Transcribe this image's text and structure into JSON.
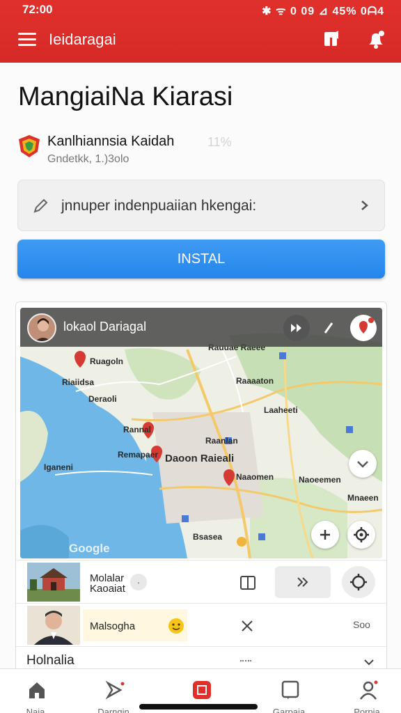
{
  "status_bar": {
    "time": "72:00",
    "indicators": "✱ ᯤ 0 09 ⊿ 45% 0ᗩ4"
  },
  "app_bar": {
    "title": "Ieidaragai",
    "icons": [
      "menu-icon",
      "share-icon",
      "notification-icon"
    ]
  },
  "app": {
    "title": "MangiaiNa Kiarasi",
    "developer": "Kanlhiannsia Kaidah",
    "meta": "Gndetkk, 1.)3olo",
    "count": "11%",
    "search_text": "jnnuper indenpuaiian hkengai:",
    "install_label": "INSTAL"
  },
  "map_card": {
    "header_title": "lokaol Dariagal",
    "watermark": "Google",
    "places": [
      "Ruagoln",
      "Riaiidsa",
      "Deraoli",
      "Rannal",
      "Remapaer",
      "Iganeni",
      "Rauuae Raeee",
      "Daoon Raieali",
      "Naaomen",
      "Raaaaton",
      "Laaheeti",
      "Raanlan",
      "Naoeemen",
      "Mnaeen",
      "Bsasea"
    ],
    "rows": [
      {
        "label": "Molalar Kaoaiat",
        "badge": "·"
      },
      {
        "label": "Malsogha",
        "more": "Soo"
      }
    ]
  },
  "section": {
    "title": "Holnalia"
  },
  "bottom_nav": [
    {
      "label": "Naia",
      "icon": "home-icon"
    },
    {
      "label": "Darngin",
      "icon": "explore-icon"
    },
    {
      "label": "",
      "icon": "apps-icon"
    },
    {
      "label": "Garpaia",
      "icon": "library-icon"
    },
    {
      "label": "Porpia",
      "icon": "profile-icon"
    }
  ],
  "colors": {
    "app_bar": "#d62a27",
    "install": "#2486ec",
    "water": "#6eb7e6",
    "land": "#eef0e6"
  }
}
